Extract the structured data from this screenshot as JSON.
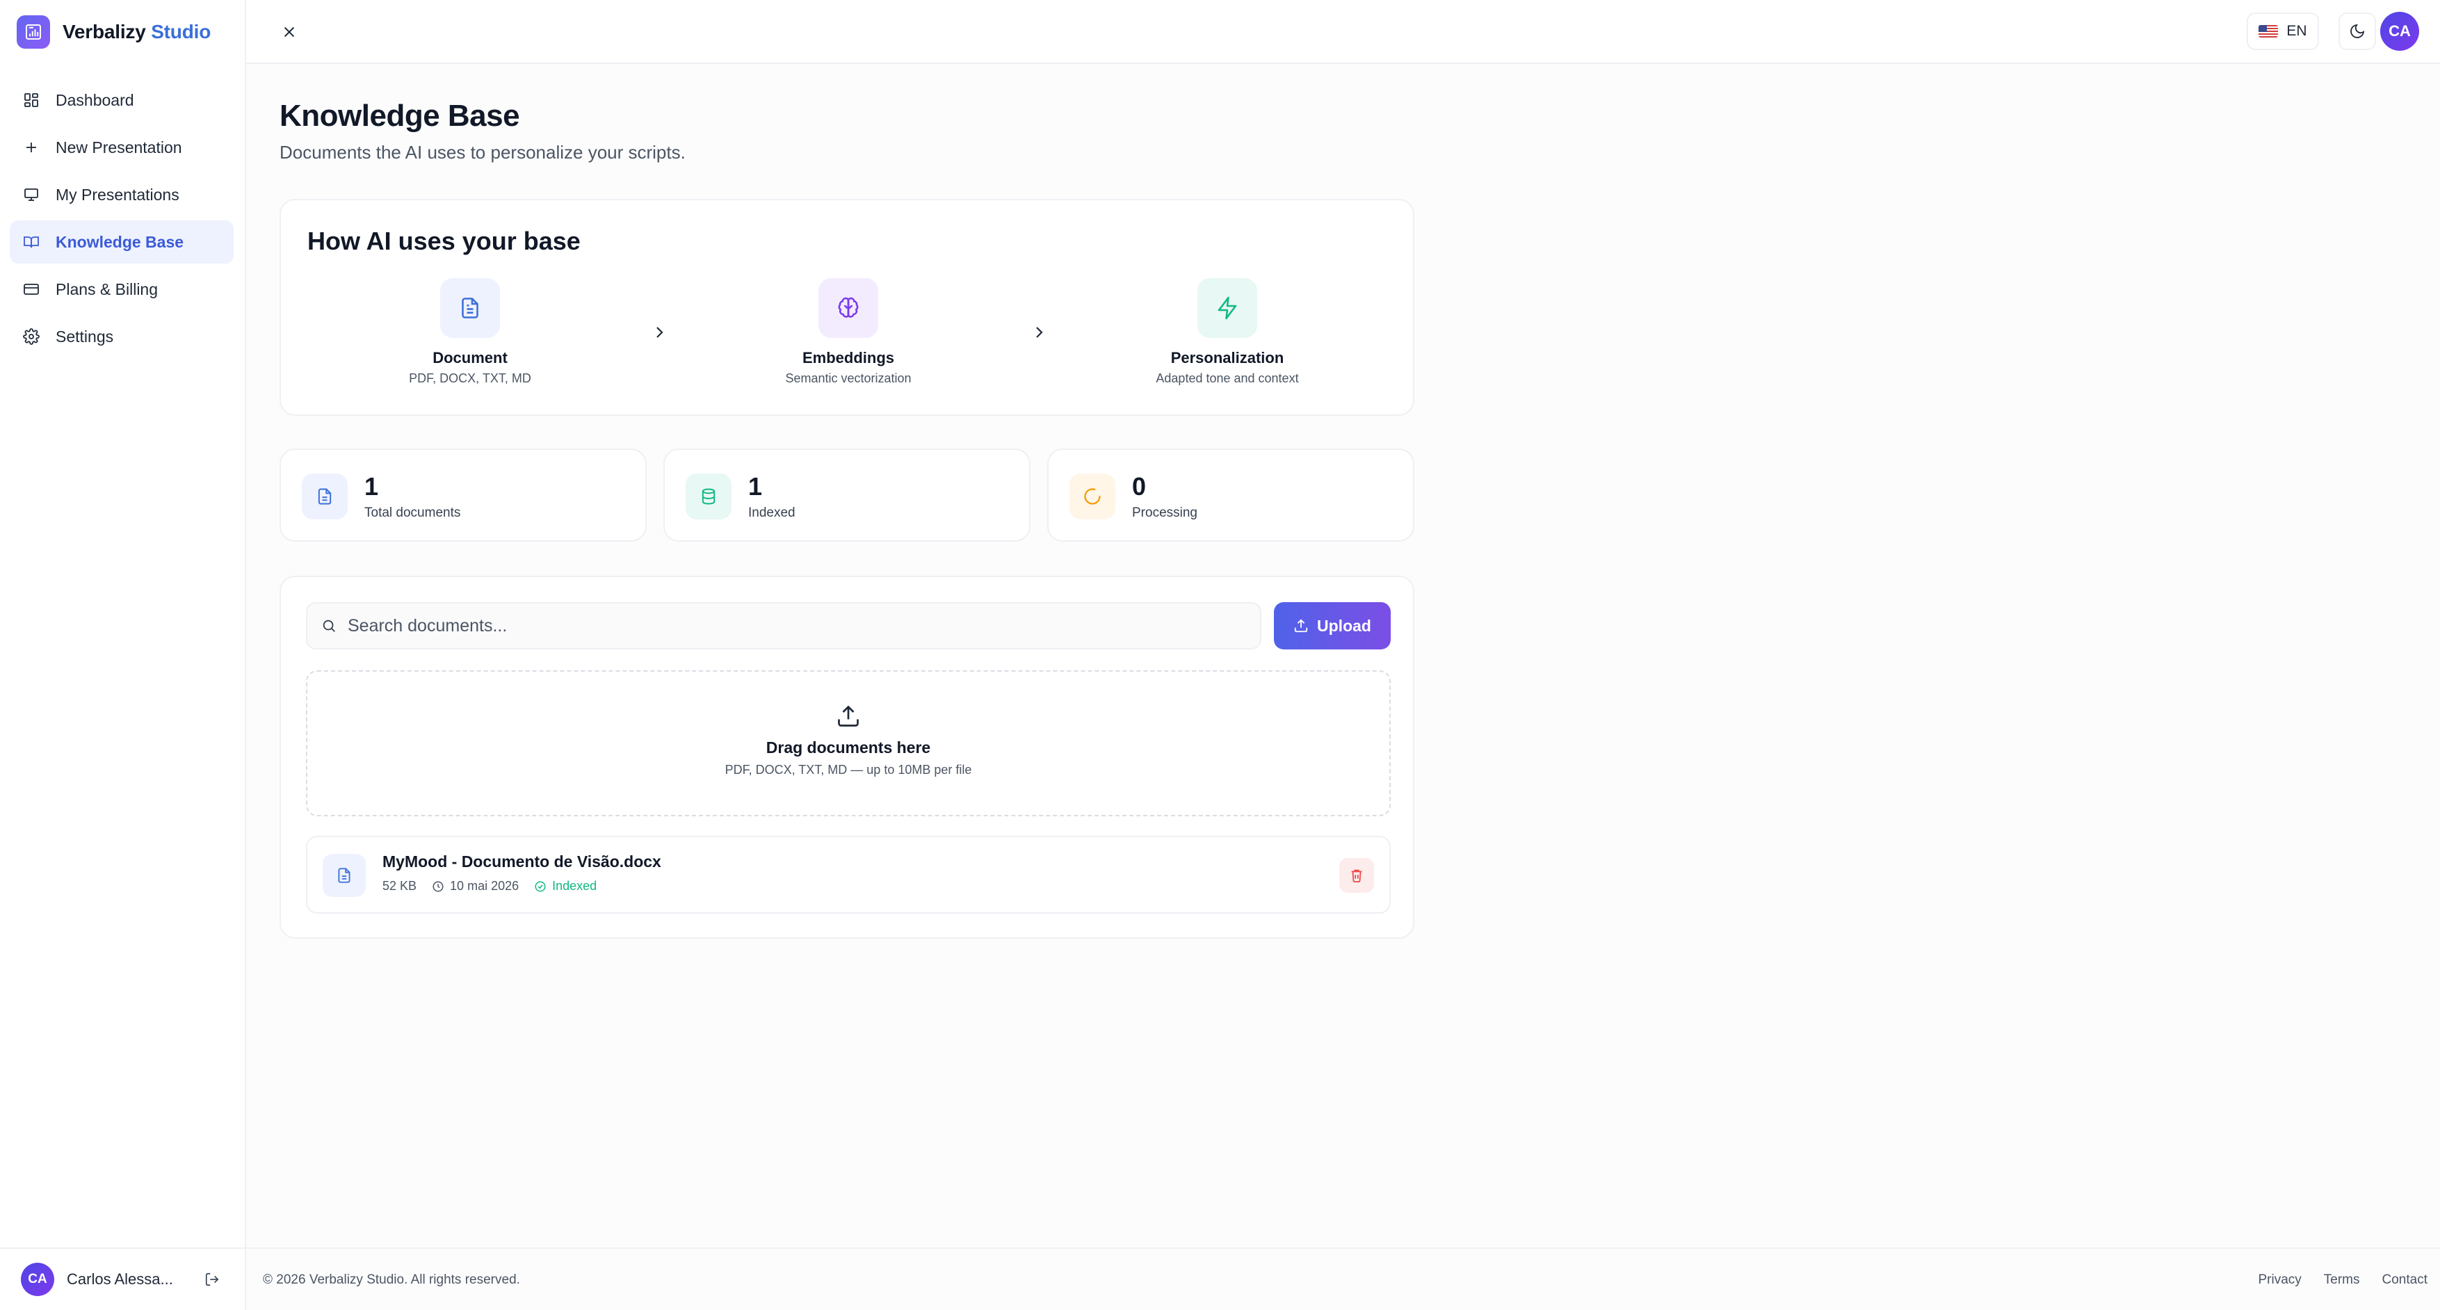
{
  "app": {
    "name_main": "Verbalizy",
    "name_accent": "Studio"
  },
  "sidebar": {
    "items": [
      {
        "label": "Dashboard",
        "icon": "dashboard-icon",
        "active": false
      },
      {
        "label": "New Presentation",
        "icon": "plus-icon",
        "active": false
      },
      {
        "label": "My Presentations",
        "icon": "presentation-icon",
        "active": false
      },
      {
        "label": "Knowledge Base",
        "icon": "book-open-icon",
        "active": true
      },
      {
        "label": "Plans & Billing",
        "icon": "credit-card-icon",
        "active": false
      },
      {
        "label": "Settings",
        "icon": "gear-icon",
        "active": false
      }
    ],
    "user": {
      "initials": "CA",
      "name": "Carlos Alessa..."
    }
  },
  "topbar": {
    "language": "EN",
    "avatar_initials": "CA"
  },
  "page": {
    "title": "Knowledge Base",
    "subtitle": "Documents the AI uses to personalize your scripts."
  },
  "how": {
    "title": "How AI uses your base",
    "steps": [
      {
        "name": "Document",
        "desc": "PDF, DOCX, TXT, MD",
        "icon": "file-text-icon"
      },
      {
        "name": "Embeddings",
        "desc": "Semantic vectorization",
        "icon": "brain-icon"
      },
      {
        "name": "Personalization",
        "desc": "Adapted tone and context",
        "icon": "lightning-icon"
      }
    ]
  },
  "stats": [
    {
      "value": "1",
      "label": "Total documents",
      "icon": "file-text-icon"
    },
    {
      "value": "1",
      "label": "Indexed",
      "icon": "database-icon"
    },
    {
      "value": "0",
      "label": "Processing",
      "icon": "spinner-icon"
    }
  ],
  "documents": {
    "search_placeholder": "Search documents...",
    "upload_label": "Upload",
    "dropzone_title": "Drag documents here",
    "dropzone_desc": "PDF, DOCX, TXT, MD — up to 10MB per file",
    "items": [
      {
        "name": "MyMood - Documento de Visão.docx",
        "size": "52 KB",
        "date": "10 mai 2026",
        "status": "Indexed"
      }
    ]
  },
  "footer": {
    "copyright": "© 2026 Verbalizy Studio. All rights reserved.",
    "links": [
      "Privacy",
      "Terms",
      "Contact"
    ]
  },
  "colors": {
    "accent": "#4f63e8",
    "active_nav_bg": "#eef2ff",
    "indexed": "#10b981",
    "danger": "#ef4444"
  }
}
